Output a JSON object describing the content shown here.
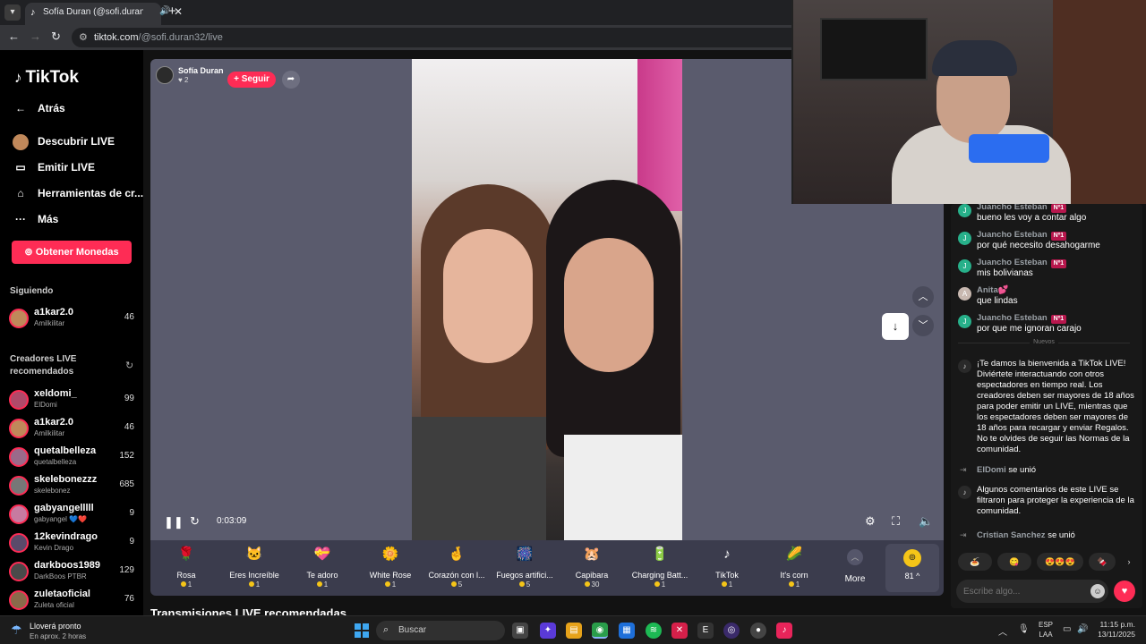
{
  "browser": {
    "tab_title": "Sofía Duran (@sofi.duran32) | ...",
    "url_host": "tiktok.com",
    "url_path": "/@sofi.duran32/live"
  },
  "sidebar": {
    "logo_text": "TikTok",
    "nav": [
      {
        "label": "Atrás",
        "icon": "arrow-left-icon"
      },
      {
        "label": "Descubrir LIVE",
        "icon": "live-avatar-icon"
      },
      {
        "label": "Emitir LIVE",
        "icon": "camera-icon"
      },
      {
        "label": "Herramientas de cr...",
        "icon": "tools-icon"
      },
      {
        "label": "Más",
        "icon": "more-icon"
      }
    ],
    "coins_button": "Obtener Monedas",
    "following_title": "Siguiendo",
    "following": [
      {
        "name": "a1kar2.0",
        "sub": "Amilkilitar",
        "count": "46"
      }
    ],
    "recommended_title_1": "Creadores LIVE",
    "recommended_title_2": "recomendados",
    "recommended": [
      {
        "name": "xeldomi_",
        "sub": "ElDomi",
        "count": "99"
      },
      {
        "name": "a1kar2.0",
        "sub": "Amilkilitar",
        "count": "46"
      },
      {
        "name": "quetalbelleza",
        "sub": "quetalbelleza",
        "count": "152"
      },
      {
        "name": "skelebonezzz",
        "sub": "skelebonez",
        "count": "685"
      },
      {
        "name": "gabyangelllll",
        "sub": "gabyangel 💙❤️",
        "count": "9"
      },
      {
        "name": "12kevindrago",
        "sub": "Kevin Drago",
        "count": "9"
      },
      {
        "name": "darkboos1989",
        "sub": "DarkBoos PTBR",
        "count": "129"
      },
      {
        "name": "zuletaoficial",
        "sub": "Zuleta oficial",
        "count": "76"
      }
    ]
  },
  "player": {
    "host_name": "Sofía Duran",
    "host_likes": "2",
    "follow_label": "+ Seguir",
    "timecode": "0:03:09"
  },
  "gifts": [
    {
      "name": "Rosa",
      "price": "1",
      "icon": "🌹",
      "color": "#c2184a"
    },
    {
      "name": "Eres Increíble",
      "price": "1",
      "icon": "🐱",
      "color": "#b89070"
    },
    {
      "name": "Te adoro",
      "price": "1",
      "icon": "💝",
      "color": "#e84a2a"
    },
    {
      "name": "White Rose",
      "price": "1",
      "icon": "🌼",
      "color": "#e8e8e8"
    },
    {
      "name": "Corazón con l...",
      "price": "5",
      "icon": "🤞",
      "color": "#e7a07a"
    },
    {
      "name": "Fuegos artifici...",
      "price": "5",
      "icon": "🎆",
      "color": "#7a4ae8"
    },
    {
      "name": "Capibara",
      "price": "30",
      "icon": "🐹",
      "color": "#8a5a30"
    },
    {
      "name": "Charging Batt...",
      "price": "1",
      "icon": "🔋",
      "color": "#3adb5a"
    },
    {
      "name": "TikTok",
      "price": "1",
      "icon": "♪",
      "color": "#ffffff"
    },
    {
      "name": "It's corn",
      "price": "1",
      "icon": "🌽",
      "color": "#f5c518"
    }
  ],
  "gift_more_label": "More",
  "wallet_value": "81",
  "recommended_streams_title": "Transmisiones LIVE recomendadas",
  "chat": {
    "messages": [
      {
        "user": "Juancho Esteban",
        "badge": "Nº1",
        "text": "bueno les voy a contar algo",
        "avatar_letter": "J"
      },
      {
        "user": "Juancho Esteban",
        "badge": "Nº1",
        "text": "por qué necesito desahogarme",
        "avatar_letter": "J"
      },
      {
        "user": "Juancho Esteban",
        "badge": "Nº1",
        "text": "mis bolivianas",
        "avatar_letter": "J"
      },
      {
        "user": "Anita💕",
        "badge": "",
        "text": "que lindas",
        "avatar_letter": "A"
      },
      {
        "user": "Juancho Esteban",
        "badge": "Nº1",
        "text": "por que me ignoran carajo",
        "avatar_letter": "J"
      }
    ],
    "divider_label": "Nuevos",
    "welcome": "¡Te damos la bienvenida a TikTok LIVE! Diviértete interactuando con otros espectadores en tiempo real. Los creadores deben ser mayores de 18 años para poder emitir un LIVE, mientras que los espectadores deben ser mayores de 18 años para recargar y enviar Regalos. No te olvides de seguir las Normas de la comunidad.",
    "join_1_user": "ElDomi",
    "join_1_text": "se unió",
    "filtered": "Algunos comentarios de este LIVE se filtraron para proteger la experiencia de la comunidad.",
    "join_2_user": "Cristian Sanchez",
    "join_2_text": "se unió",
    "quick": [
      "🍝",
      "😋",
      "😍😍😍",
      "🍫"
    ],
    "input_placeholder": "Escribe algo..."
  },
  "taskbar": {
    "weather_line1": "Lloverá pronto",
    "weather_line2": "En aprox. 2 horas",
    "search_label": "Buscar",
    "lang_1": "ESP",
    "lang_2": "LAA",
    "time": "11:15 p.m.",
    "date": "13/11/2025"
  }
}
